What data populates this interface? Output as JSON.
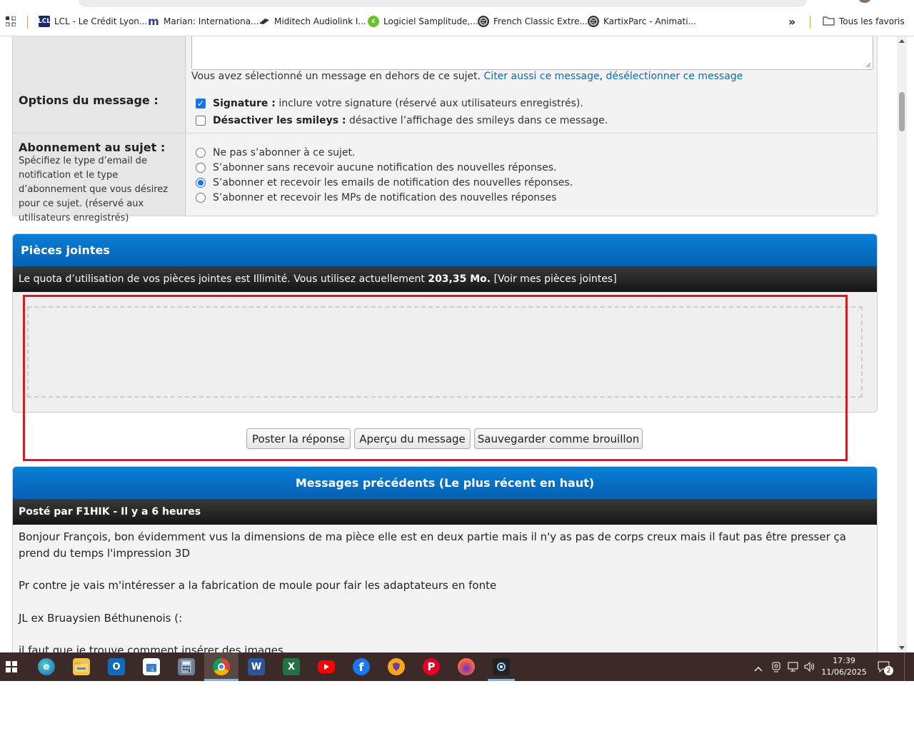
{
  "bookmarks": {
    "items": [
      {
        "label": "LCL - Le Crédit Lyon...",
        "icon": "lcl-icon",
        "color": "#1c2a6b"
      },
      {
        "label": "Marian: Internationa...",
        "icon": "marian-icon",
        "color": "#2b3f8c"
      },
      {
        "label": "Miditech Audiolink I...",
        "icon": "miditech-icon",
        "color": "#333333"
      },
      {
        "label": "Logiciel Samplitude,...",
        "icon": "samplitude-icon",
        "color": "#6bbf2a"
      },
      {
        "label": "French Classic Extre...",
        "icon": "globe-icon",
        "color": "#333333"
      },
      {
        "label": "KartixParc - Animati...",
        "icon": "globe-icon",
        "color": "#333333"
      }
    ],
    "more": "»",
    "all_favorites": "Tous les favoris"
  },
  "form": {
    "selected_note": "Vous avez sélectionné un message en dehors de ce sujet.",
    "quote_link": "Citer aussi ce message",
    "comma": ",",
    "deselect_link": "désélectionner ce message",
    "options": {
      "label": "Options du message :",
      "signature_title": "Signature :",
      "signature_desc": "inclure votre signature (réservé aux utilisateurs enregistrés).",
      "signature_checked": true,
      "smileys_title": "Désactiver les smileys :",
      "smileys_desc": "désactive l’affichage des smileys dans ce message.",
      "smileys_checked": false
    },
    "subscription": {
      "label": "Abonnement au sujet :",
      "help": "Spécifiez le type d’email de notification et le type d’abonnement que vous désirez pour ce sujet. (réservé aux utilisateurs enregistrés)",
      "options": [
        "Ne pas s’abonner à ce sujet.",
        "S’abonner sans recevoir aucune notification des nouvelles réponses.",
        "S’abonner et recevoir les emails de notification des nouvelles réponses.",
        "S’abonner et recevoir les MPs de notification des nouvelles réponses"
      ],
      "selected_index": 2
    }
  },
  "attachments": {
    "title": "Pièces jointes",
    "quota_text": "Le quota d’utilisation de vos pièces jointes est Illimité. Vous utilisez actuellement",
    "usage": "203,35 Mo.",
    "view_link": "[Voir mes pièces jointes]"
  },
  "buttons": {
    "post": "Poster la réponse",
    "preview": "Aperçu du message",
    "draft": "Sauvegarder comme brouillon"
  },
  "previous": {
    "title": "Messages précédents (Le plus récent en haut)",
    "post_header": "Posté par F1HIK - Il y a 6 heures",
    "paragraphs": [
      "Bonjour François, bon évidemment vus la dimensions de ma pièce elle est en deux partie mais il n'y as pas de corps creux mais il faut pas être presser ça prend du temps l'impression 3D",
      "Pr contre je vais m'intéresser a la fabrication de moule pour fair les adaptateurs en fonte",
      "JL ex Bruaysien Béthunenois (:",
      "il faut que je trouve comment insérer des images"
    ]
  },
  "highlight_color": "#e3141c",
  "taskbar": {
    "time": "17:39",
    "date": "11/06/2025",
    "notification_count": "2",
    "apps": [
      "edge-icon",
      "file-explorer-icon",
      "outlook-icon",
      "store-icon",
      "calculator-icon",
      "chrome-icon",
      "word-icon",
      "excel-icon",
      "youtube-icon",
      "facebook-icon",
      "brave-icon",
      "pinterest-icon",
      "firefox-icon",
      "app-icon"
    ]
  }
}
